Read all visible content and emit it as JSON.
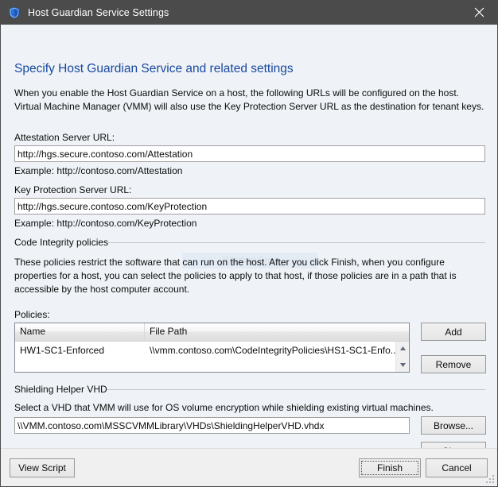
{
  "window": {
    "title": "Host Guardian Service Settings",
    "icon": "shield-icon",
    "close_label": "✕",
    "accent_color": "#17489e",
    "titlebar_color": "#4b4b4b",
    "content_background": "#eff3f7"
  },
  "page": {
    "heading": "Specify Host Guardian Service and related settings",
    "intro_line1": "When you enable the Host Guardian Service on a host, the following URLs will be configured on the host.",
    "intro_line2": "Virtual Machine Manager (VMM) will also use the Key Protection Server URL as the destination for tenant keys."
  },
  "attestation": {
    "label": "Attestation Server URL:",
    "value": "http://hgs.secure.contoso.com/Attestation",
    "placeholder": "",
    "example": "Example: http://contoso.com/Attestation"
  },
  "key_protection": {
    "label": "Key Protection Server URL:",
    "value": "http://hgs.secure.contoso.com/KeyProtection",
    "placeholder": "",
    "example": "Example: http://contoso.com/KeyProtection"
  },
  "code_integrity": {
    "group_title": "Code Integrity policies",
    "description_line1": "These policies restrict the software that can run on the host. After you click Finish, when you configure",
    "description_line2": "properties for a host, you can select the policies to apply to that host, if those policies are in a path that is",
    "description_line3": "accessible by the host computer account.",
    "watermark": "Window Snip",
    "policies_label": "Policies:",
    "columns": [
      "Name",
      "File Path"
    ],
    "rows": [
      {
        "name": "HW1-SC1-Enforced",
        "path": "\\\\vmm.contoso.com\\CodeIntegrityPolicies\\HS1-SC1-Enfo..."
      }
    ],
    "add_label": "Add",
    "remove_label": "Remove",
    "scroll_up_icon": "triangle-up-icon",
    "scroll_down_icon": "triangle-down-icon"
  },
  "shielding_vhd": {
    "group_title": "Shielding Helper VHD",
    "description": "Select a VHD that VMM will use for OS volume encryption while shielding existing virtual machines.",
    "value": "\\\\VMM.contoso.com\\MSSCVMMLibrary\\VHDs\\ShieldingHelperVHD.vhdx",
    "placeholder": "",
    "browse_label": "Browse...",
    "clear_label": "Clear"
  },
  "footer": {
    "view_script_label": "View Script",
    "finish_label": "Finish",
    "cancel_label": "Cancel",
    "resize_grip": "resize-grip-icon"
  }
}
